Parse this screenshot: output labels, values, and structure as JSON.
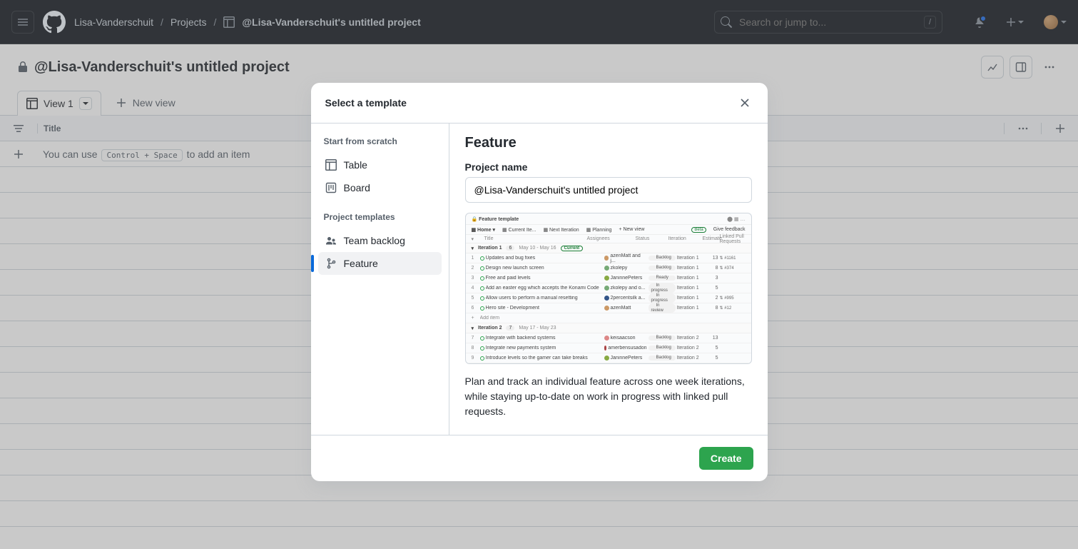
{
  "header": {
    "user": "Lisa-Vanderschuit",
    "projects_crumb": "Projects",
    "project_name_crumb": "@Lisa-Vanderschuit's untitled project",
    "search_placeholder": "Search or jump to...",
    "search_kbd": "/"
  },
  "project": {
    "title": "@Lisa-Vanderschuit's untitled project"
  },
  "views": {
    "tab_label": "View 1",
    "new_view_label": "New view"
  },
  "columns": {
    "title_label": "Title"
  },
  "add_row": {
    "prefix": "You can use ",
    "kbd": "Control + Space",
    "suffix": " to add an item"
  },
  "modal": {
    "title": "Select a template",
    "scratch_header": "Start from scratch",
    "scratch_items": [
      "Table",
      "Board"
    ],
    "templates_header": "Project templates",
    "template_items": [
      "Team backlog",
      "Feature"
    ],
    "main_title": "Feature",
    "field_label": "Project name",
    "field_value": "@Lisa-Vanderschuit's untitled project",
    "description": "Plan and track an individual feature across one week iterations, while staying up-to-date on work in progress with linked pull requests.",
    "create_label": "Create"
  },
  "preview": {
    "title": "Feature template",
    "tabs": [
      "Home",
      "Current Ite...",
      "Next Iteration",
      "Planning",
      "New view"
    ],
    "beta": "Beta",
    "feedback": "Give feedback",
    "col_headers": [
      "Title",
      "Assignees",
      "Status",
      "Iteration",
      "Estimate",
      "Linked Pull Requests"
    ],
    "iterations": [
      {
        "name": "Iteration 1",
        "badge": "6",
        "dates": "May 10 - May 16",
        "current": true,
        "rows": [
          {
            "n": "1",
            "title": "Updates and bug fixes",
            "asn": "azenMatt and j...",
            "av": "#c96",
            "status": "Backlog",
            "iter": "Iteration 1",
            "est": "13",
            "pr": "#1161"
          },
          {
            "n": "2",
            "title": "Design new launch screen",
            "asn": "zkolepy",
            "av": "#7a7",
            "status": "Backlog",
            "iter": "Iteration 1",
            "est": "8",
            "pr": "#374"
          },
          {
            "n": "3",
            "title": "Free and paid levels",
            "asn": "JaninnePeters",
            "av": "#8a4",
            "status": "Ready",
            "iter": "Iteration 1",
            "est": "3",
            "pr": ""
          },
          {
            "n": "4",
            "title": "Add an easter egg which accepts the Konami Code",
            "asn": "zkolepy and o...",
            "av": "#7a7",
            "status": "In progress",
            "iter": "Iteration 1",
            "est": "5",
            "pr": ""
          },
          {
            "n": "5",
            "title": "Allow users to perform a manual resetting",
            "asn": "2percentsilk a...",
            "av": "#358",
            "status": "In progress",
            "iter": "Iteration 1",
            "est": "2",
            "pr": "#995"
          },
          {
            "n": "6",
            "title": "Hero site - Development",
            "asn": "azenMatt",
            "av": "#c96",
            "status": "In review",
            "iter": "Iteration 1",
            "est": "8",
            "pr": "#12"
          }
        ],
        "add_item": "Add item"
      },
      {
        "name": "Iteration 2",
        "badge": "7",
        "dates": "May 17 - May 23",
        "current": false,
        "rows": [
          {
            "n": "7",
            "title": "Integrate with backend systems",
            "asn": "keisaacson",
            "av": "#d88",
            "status": "Backlog",
            "iter": "Iteration 2",
            "est": "13",
            "pr": ""
          },
          {
            "n": "8",
            "title": "Integrate new payments system",
            "asn": "amerbensusadon",
            "av": "#a44",
            "status": "Backlog",
            "iter": "Iteration 2",
            "est": "5",
            "pr": ""
          },
          {
            "n": "9",
            "title": "Introduce levels so the gamer can take breaks",
            "asn": "JaninnePeters",
            "av": "#8a4",
            "status": "Backlog",
            "iter": "Iteration 2",
            "est": "5",
            "pr": ""
          }
        ]
      }
    ]
  }
}
